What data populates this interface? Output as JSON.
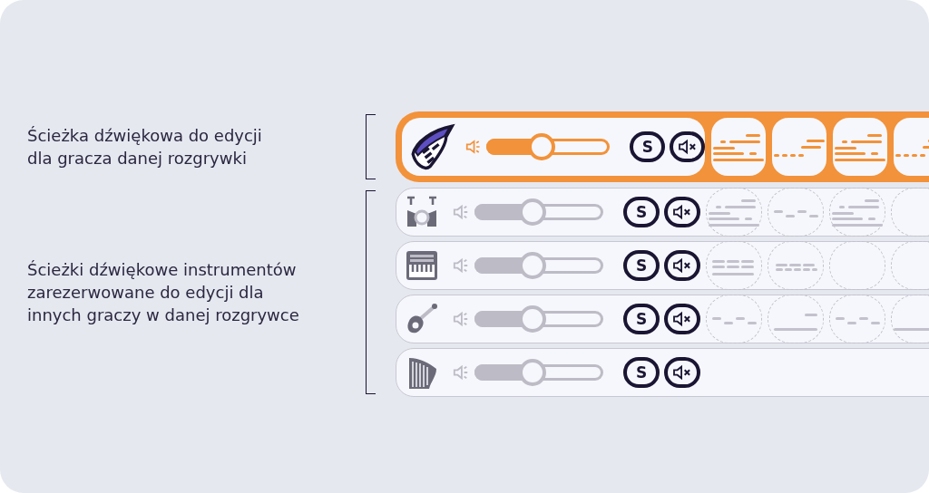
{
  "groups": [
    {
      "label_lines": [
        "Ścieżka dźwiękowa do edycji",
        "dla gracza danej rozgrywki"
      ],
      "tracks": [
        {
          "kind": "keytar",
          "selected": true,
          "level": 0.45,
          "solo": "S",
          "clips": [
            {
              "kind": "stairs"
            },
            {
              "kind": "dashes"
            },
            {
              "kind": "stairs"
            },
            {
              "kind": "dashes"
            }
          ]
        }
      ]
    },
    {
      "label_lines": [
        "Ścieżki dźwiękowe instrumentów",
        "zarezerwowane do edycji dla",
        "innych graczy w danej rozgrywce"
      ],
      "tracks": [
        {
          "kind": "drums",
          "selected": false,
          "level": 0.45,
          "solo": "S",
          "clips": [
            {
              "kind": "stairs"
            },
            {
              "kind": "zigzag"
            },
            {
              "kind": "stairs"
            },
            {
              "kind": "empty"
            }
          ]
        },
        {
          "kind": "synth",
          "selected": false,
          "level": 0.45,
          "solo": "S",
          "clips": [
            {
              "kind": "blocks"
            },
            {
              "kind": "blocks_small"
            },
            {
              "kind": "empty"
            },
            {
              "kind": "empty"
            }
          ]
        },
        {
          "kind": "guitar",
          "selected": false,
          "level": 0.45,
          "solo": "S",
          "clips": [
            {
              "kind": "zigzag"
            },
            {
              "kind": "riser"
            },
            {
              "kind": "zigzag"
            },
            {
              "kind": "line"
            }
          ]
        },
        {
          "kind": "harp",
          "selected": false,
          "level": 0.45,
          "solo": "S"
        }
      ]
    }
  ]
}
